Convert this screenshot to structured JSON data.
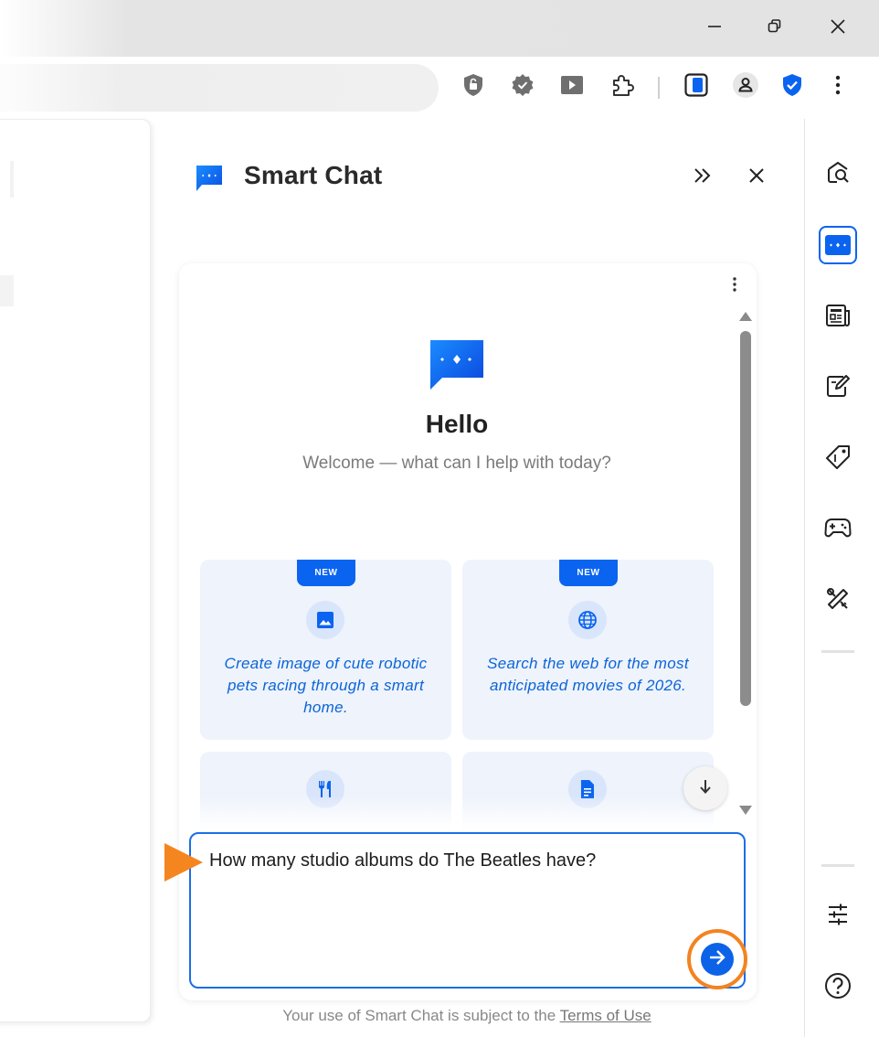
{
  "window": {
    "minimize_icon": "minimize-icon",
    "restore_icon": "restore-icon",
    "close_icon": "close-icon"
  },
  "toolbar": {
    "icons": [
      "lock-shield-icon",
      "verified-badge-icon",
      "video-play-icon",
      "puzzle-extension-icon",
      "sidebar-toggle-icon",
      "profile-icon",
      "security-shield-icon",
      "more-vertical-icon"
    ],
    "accent": "#0b64f0"
  },
  "panel": {
    "title": "Smart Chat",
    "collapse_icon": "double-chevron-right-icon",
    "close_icon": "close-icon"
  },
  "chat": {
    "greeting": "Hello",
    "subtitle": "Welcome — what can I help with today?",
    "suggestions": [
      {
        "badge": "NEW",
        "icon": "image-icon",
        "text": "Create image of cute robotic pets racing through a smart home."
      },
      {
        "badge": "NEW",
        "icon": "globe-icon",
        "text": "Search the web for the most anticipated movies of 2026."
      },
      {
        "badge": "",
        "icon": "utensils-icon",
        "text": ""
      },
      {
        "badge": "",
        "icon": "document-icon",
        "text": ""
      }
    ],
    "input_value": "How many studio albums do The Beatles have?",
    "footer_prefix": "Your use of Smart Chat is subject to the ",
    "footer_link": "Terms of Use"
  },
  "rail": {
    "icons": [
      "search-page-icon",
      "smart-chat-icon",
      "news-icon",
      "notes-edit-icon",
      "tag-price-icon",
      "gamepad-icon",
      "tools-icon",
      "sliders-icon",
      "help-icon"
    ]
  },
  "colors": {
    "highlight_orange": "#f38320",
    "primary_blue": "#0d63e8",
    "suggestion_bg": "#eef3fc"
  }
}
